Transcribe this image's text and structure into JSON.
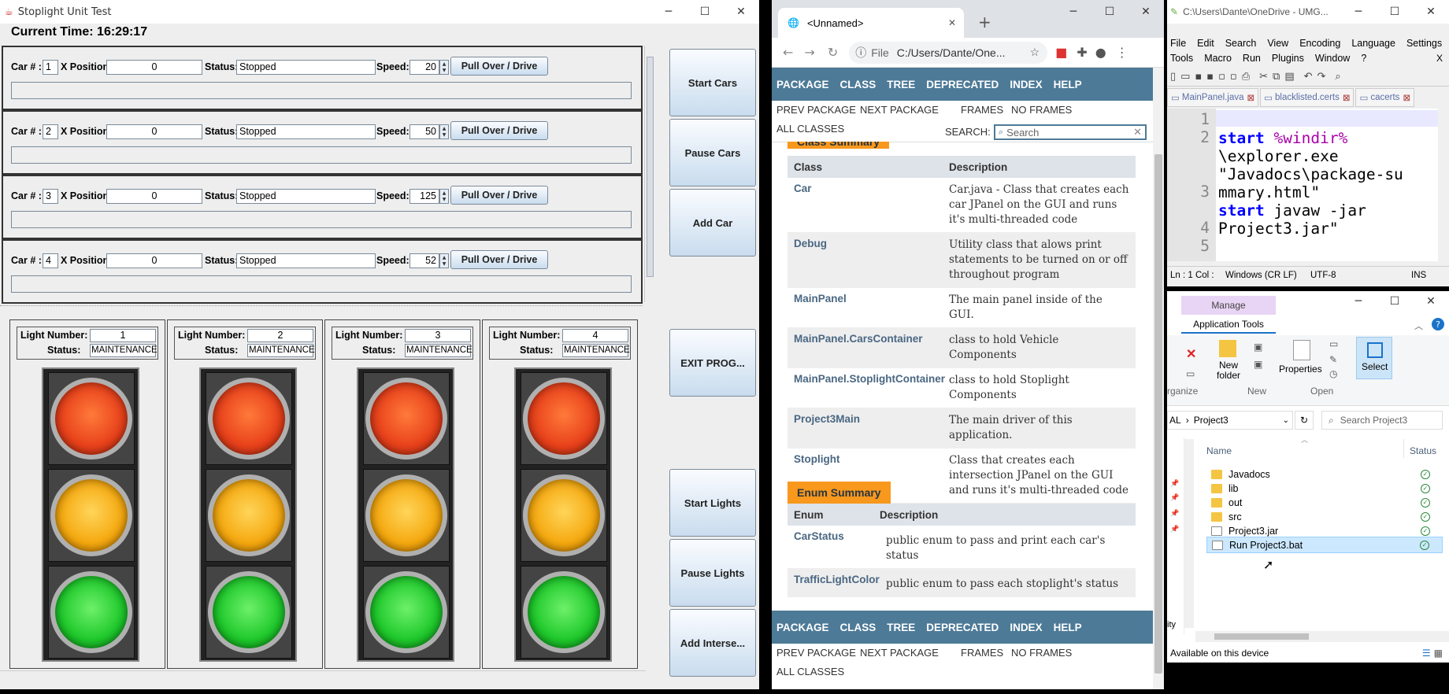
{
  "java_window": {
    "title": "Stoplight Unit Test",
    "current_time_label": "Current Time: 16:29:17",
    "labels": {
      "car": "Car # :",
      "xpos": "X Position:",
      "status": "Status:",
      "speed": "Speed:"
    },
    "cars": [
      {
        "num": "1",
        "xpos": "0",
        "status": "Stopped",
        "speed": "20",
        "button": "Pull Over / Drive"
      },
      {
        "num": "2",
        "xpos": "0",
        "status": "Stopped",
        "speed": "50",
        "button": "Pull Over / Drive"
      },
      {
        "num": "3",
        "xpos": "0",
        "status": "Stopped",
        "speed": "125",
        "button": "Pull Over / Drive"
      },
      {
        "num": "4",
        "xpos": "0",
        "status": "Stopped",
        "speed": "52",
        "button": "Pull Over / Drive"
      }
    ],
    "side_buttons": [
      "Start Cars",
      "Pause Cars",
      "Add Car",
      "EXIT PROG...",
      "Start Lights",
      "Pause Lights",
      "Add Interse..."
    ],
    "light_labels": {
      "number": "Light Number:",
      "status": "Status:"
    },
    "lights": [
      {
        "number": "1",
        "status": "MAINTENANCE"
      },
      {
        "number": "2",
        "status": "MAINTENANCE"
      },
      {
        "number": "3",
        "status": "MAINTENANCE"
      },
      {
        "number": "4",
        "status": "MAINTENANCE"
      }
    ],
    "colors": {
      "red": "#e8401a",
      "yellow": "#f5a80e",
      "green": "#1dc82a"
    }
  },
  "browser": {
    "tab_title": "<Unnamed>",
    "address_scheme": "File",
    "address": "C:/Users/Dante/One...",
    "nav_top": [
      "PACKAGE",
      "CLASS",
      "TREE",
      "DEPRECATED",
      "INDEX",
      "HELP"
    ],
    "prev_package": "PREV PACKAGE",
    "next_package": "NEXT PACKAGE",
    "frames": "FRAMES",
    "no_frames": "NO FRAMES",
    "all_classes": "ALL CLASSES",
    "search_label": "SEARCH:",
    "search_placeholder": "Search",
    "class_summary_caption": "Class Summary",
    "class_header": [
      "Class",
      "Description"
    ],
    "classes": [
      {
        "name": "Car",
        "desc": "Car.java - Class that creates each car JPanel on the GUI and runs it's multi-threaded code"
      },
      {
        "name": "Debug",
        "desc": "Utility class that alows print statements to be turned on or off throughout program"
      },
      {
        "name": "MainPanel",
        "desc": "The main panel inside of the GUI."
      },
      {
        "name": "MainPanel.CarsContainer",
        "desc": "class to hold Vehicle Components"
      },
      {
        "name": "MainPanel.StoplightContainer",
        "desc": "class to hold Stoplight Components"
      },
      {
        "name": "Project3Main",
        "desc": "The main driver of this application."
      },
      {
        "name": "Stoplight",
        "desc": "Class that creates each intersection JPanel on the GUI and runs it's multi-threaded code"
      }
    ],
    "enum_summary_caption": "Enum Summary",
    "enum_header": [
      "Enum",
      "Description"
    ],
    "enums": [
      {
        "name": "CarStatus",
        "desc": "public enum to pass and print each car's status"
      },
      {
        "name": "TrafficLightColor",
        "desc": "public enum to pass each stoplight's status"
      }
    ],
    "nav_bottom": [
      "PACKAGE",
      "CLASS",
      "TREE",
      "DEPRECATED",
      "INDEX",
      "HELP"
    ]
  },
  "notepad": {
    "title": "C:\\Users\\Dante\\OneDrive - UMG...",
    "menu1": [
      "File",
      "Edit",
      "Search",
      "View",
      "Encoding",
      "Language",
      "Settings"
    ],
    "menu2": [
      "Tools",
      "Macro",
      "Run",
      "Plugins",
      "Window",
      "?"
    ],
    "close_x": "X",
    "tabs": [
      "MainPanel.java",
      "blacklisted.certs",
      "cacerts"
    ],
    "lines": [
      "1",
      "2",
      "",
      "",
      "3",
      "",
      "4",
      "5"
    ],
    "status": {
      "pos": "Ln : 1    Col :",
      "eol": "Windows (CR LF)",
      "enc": "UTF-8",
      "mode": "INS"
    }
  },
  "explorer": {
    "manage": "Manage",
    "app_tools": "Application Tools",
    "ribbon": {
      "new_folder": "New folder",
      "properties": "Properties",
      "select": "Select",
      "organize": "rganize",
      "new": "New",
      "open": "Open"
    },
    "breadcrumb_prefix": "AL",
    "breadcrumb_sep": "›",
    "breadcrumb": "Project3",
    "search_placeholder": "Search Project3",
    "col_name": "Name",
    "col_status": "Status",
    "files": [
      {
        "name": "Javadocs",
        "type": "folder"
      },
      {
        "name": "lib",
        "type": "folder"
      },
      {
        "name": "out",
        "type": "folder"
      },
      {
        "name": "src",
        "type": "folder"
      },
      {
        "name": "Project3.jar",
        "type": "jar"
      },
      {
        "name": "Run Project3.bat",
        "type": "bat"
      }
    ],
    "side_cut": "ity",
    "status_text": "Available on this device"
  }
}
